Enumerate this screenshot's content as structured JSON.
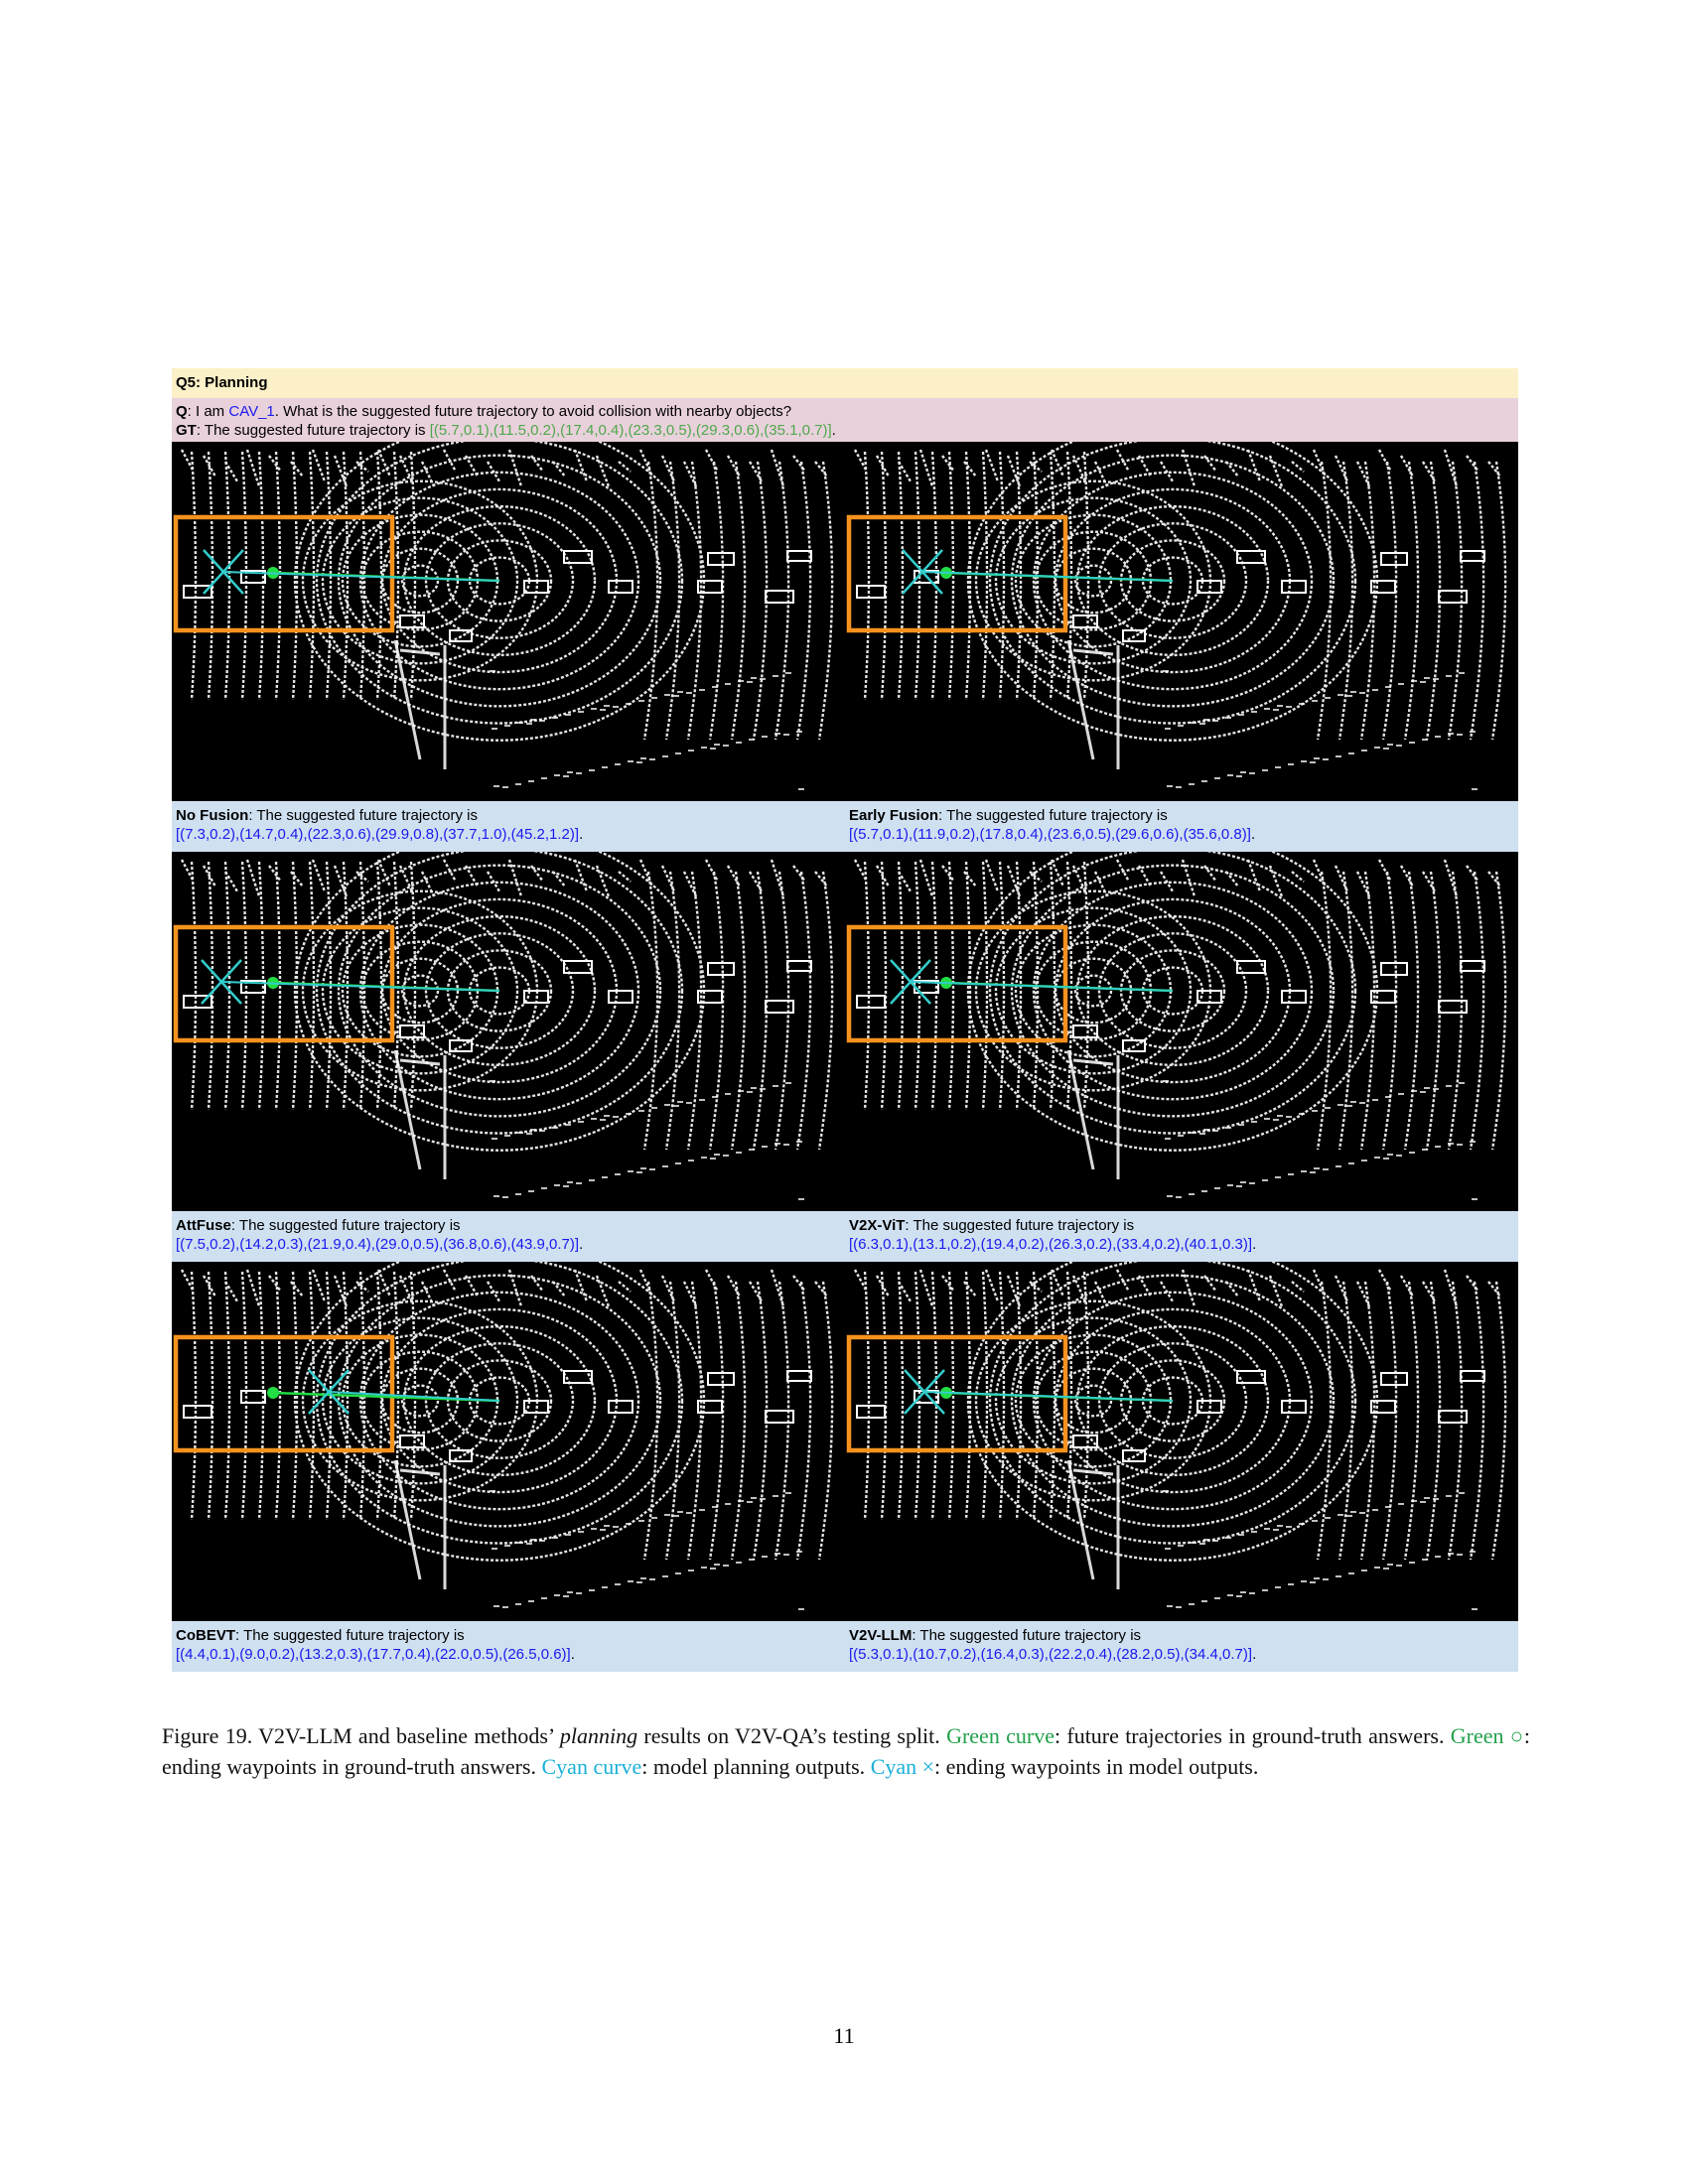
{
  "figure": {
    "header": "Q5: Planning",
    "question": {
      "q_label": "Q",
      "q_pre": ": I am ",
      "q_agent": "CAV_1",
      "q_post": ". What is the suggested future trajectory to avoid collision with nearby objects?",
      "gt_label": "GT",
      "gt_text": ": The suggested future trajectory is ",
      "gt_value": "[(5.7,0.1),(11.5,0.2),(17.4,0.4),(23.3,0.5),(29.3,0.6),(35.1,0.7)]",
      "gt_end": "."
    },
    "panels": [
      {
        "method": "No Fusion",
        "text": ": The suggested future trajectory is",
        "value": "[(7.3,0.2),(14.7,0.4),(22.3,0.6),(29.9,0.8),(37.7,1.0),(45.2,1.2)]",
        "end": "."
      },
      {
        "method": "Early Fusion",
        "text": ": The suggested future trajectory is",
        "value": "[(5.7,0.1),(11.9,0.2),(17.8,0.4),(23.6,0.5),(29.6,0.6),(35.6,0.8)]",
        "end": "."
      },
      {
        "method": "AttFuse",
        "text": ": The suggested future trajectory is",
        "value": "[(7.5,0.2),(14.2,0.3),(21.9,0.4),(29.0,0.5),(36.8,0.6),(43.9,0.7)]",
        "end": "."
      },
      {
        "method": "V2X-ViT",
        "text": ": The suggested future trajectory is",
        "value": "[(6.3,0.1),(13.1,0.2),(19.4,0.2),(26.3,0.2),(33.4,0.2),(40.1,0.3)]",
        "end": "."
      },
      {
        "method": "CoBEVT",
        "text": ": The suggested future trajectory is",
        "value": "[(4.4,0.1),(9.0,0.2),(13.2,0.3),(17.7,0.4),(22.0,0.5),(26.5,0.6)]",
        "end": "."
      },
      {
        "method": "V2V-LLM",
        "text": ": The suggested future trajectory is",
        "value": "[(5.3,0.1),(10.7,0.2),(16.4,0.3),(22.2,0.4),(28.2,0.5),(34.4,0.7)]",
        "end": "."
      }
    ]
  },
  "caption": {
    "prefix": "Figure 19.  V2V-LLM and baseline methods’ ",
    "italic": "planning",
    "after_italic": " results on V2V-QA’s testing split. ",
    "green_curve": "Green curve",
    "green_curve_desc": ": future trajectories in ground-truth answers. ",
    "green_circle": "Green ○",
    "green_circle_desc": ": ending waypoints in ground-truth answers. ",
    "cyan_curve": "Cyan curve",
    "cyan_curve_desc": ": model planning outputs. ",
    "cyan_x": "Cyan ×",
    "cyan_x_desc": ": ending waypoints in model outputs."
  },
  "page_number": "11",
  "colors": {
    "highlight_box": "#f5921e",
    "gt_trajectory": "#22dd44",
    "pred_trajectory": "#33cccc",
    "lidar_points": "#ffffff",
    "background": "#000000"
  }
}
